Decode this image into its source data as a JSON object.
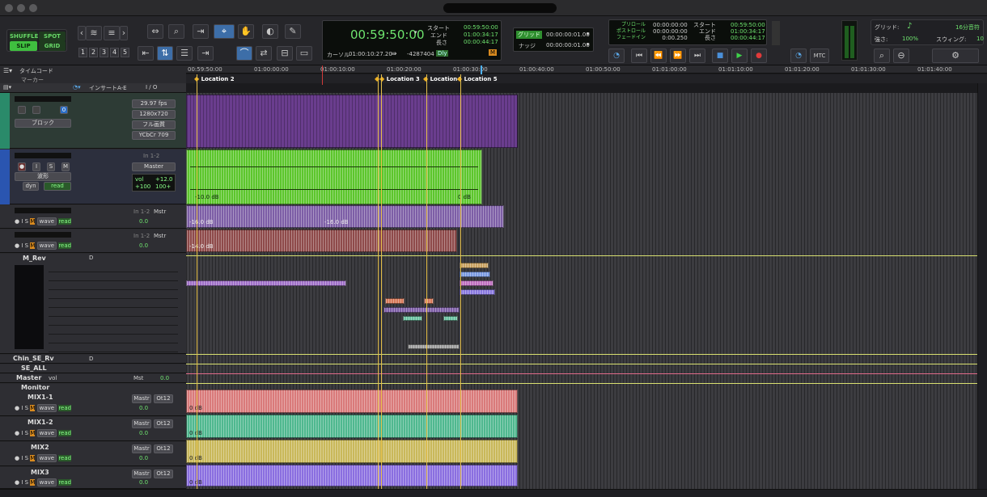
{
  "mode_buttons": {
    "shuffle": "SHUFFLE",
    "spot": "SPOT",
    "slip": "SLIP",
    "grid": "GRID"
  },
  "zoom_presets": [
    "1",
    "2",
    "3",
    "4",
    "5"
  ],
  "counter": {
    "main": "00:59:50:00",
    "start_label": "スタート",
    "start": "00:59:50:00",
    "end_label": "エンド",
    "end": "01:00:34:17",
    "length_label": "長さ",
    "length": "00:00:44:17",
    "cursor_label": "カーソル",
    "cursor": "01:00:10:27.20",
    "sample": "-4287404",
    "dly": "Dly",
    "m": "M"
  },
  "grid_nudge": {
    "grid_label": "グリッド",
    "grid_value": "00:00:00:01.00",
    "nudge_label": "ナッジ",
    "nudge_value": "00:00:00:01.00"
  },
  "transport_counter": {
    "preroll_label": "プリロール",
    "preroll": "00:00:00:00",
    "postroll_label": "ポストロール",
    "postroll": "00:00:00:00",
    "fadein_label": "フェードイン",
    "fadein": "0:00.250",
    "start_label": "スタート",
    "start": "00:59:50:00",
    "end_label": "エンド",
    "end": "01:00:34:17",
    "length_label": "長さ",
    "length": "00:00:44:17"
  },
  "mtc": "MTC",
  "grid_panel": {
    "grid_label": "グリッド:",
    "grid_value": "16分音符",
    "strength_label": "強さ:",
    "strength": "100%",
    "swing_label": "スウィング:",
    "swing": "10"
  },
  "rulers": {
    "timecode": "タイムコード",
    "marker": "マーカー"
  },
  "columns": {
    "insert": "インサートA-E",
    "io": "I / O"
  },
  "timeline_ticks": [
    "00:59:50:00",
    "01:00:00:00",
    "01:00:10:00",
    "01:00:20:00",
    "01:00:30:00",
    "01:00:40:00",
    "01:00:50:00",
    "01:01:00:00",
    "01:01:10:00",
    "01:01:20:00",
    "01:01:30:00",
    "01:01:40:00"
  ],
  "locations": [
    "Location 2",
    "Location 3",
    "Location4",
    "Location 5"
  ],
  "video_track": {
    "fps": "29.97 fps",
    "res": "1280x720",
    "quality": "フル画質",
    "codec": "YCbCr 709",
    "block": "ブロック"
  },
  "audio1": {
    "input": "In 1-2",
    "output": "Master",
    "view": "波形",
    "dyn": "dyn",
    "read": "read",
    "vol": "vol",
    "vol_val": "+12.0",
    "pan_l": "+100",
    "pan_r": "100+",
    "clip_gain_l": "-10.0 dB",
    "clip_gain_r": "0 dB"
  },
  "track2": {
    "input": "In 1-2",
    "output": "Mstr",
    "vol": "0.0",
    "clip_gain_a": "-16.0 dB",
    "clip_gain_b": "-16.0 dB"
  },
  "track3": {
    "input": "In 1-2",
    "output": "Mstr",
    "vol": "0.0",
    "clip_gain": "-14.0 dB"
  },
  "folder": {
    "name": "M_Rev",
    "d": "D"
  },
  "aux_tracks": [
    {
      "name": "Chin_SE_Rv",
      "d": "D"
    },
    {
      "name": "SE_ALL",
      "d": ""
    },
    {
      "name": "Master",
      "d": "",
      "vol": "vol",
      "mst": "Mst",
      "val": "0.0"
    },
    {
      "name": "Monitor",
      "d": ""
    }
  ],
  "mix_tracks": [
    {
      "name": "MIX1-1",
      "out1": "Mastr",
      "out2": "Ot12",
      "vol": "0.0",
      "gain": "0 dB",
      "color": "#d97a7a"
    },
    {
      "name": "MIX1-2",
      "out1": "Mastr",
      "out2": "Ot12",
      "vol": "0.0",
      "gain": "0 dB",
      "color": "#4fb88f"
    },
    {
      "name": "MIX2",
      "out1": "Mastr",
      "out2": "Ot12",
      "vol": "0.0",
      "gain": "0 dB",
      "color": "#c9b85a"
    },
    {
      "name": "MIX3",
      "out1": "Mastr",
      "out2": "Ot12",
      "vol": "0.0",
      "gain": "0 dB",
      "color": "#8a6ee0"
    }
  ],
  "track_buttons": {
    "i": "I",
    "s": "S",
    "m": "M",
    "wave": "wave",
    "read": "read",
    "p": "P",
    "v": "v",
    "p2": "p"
  }
}
